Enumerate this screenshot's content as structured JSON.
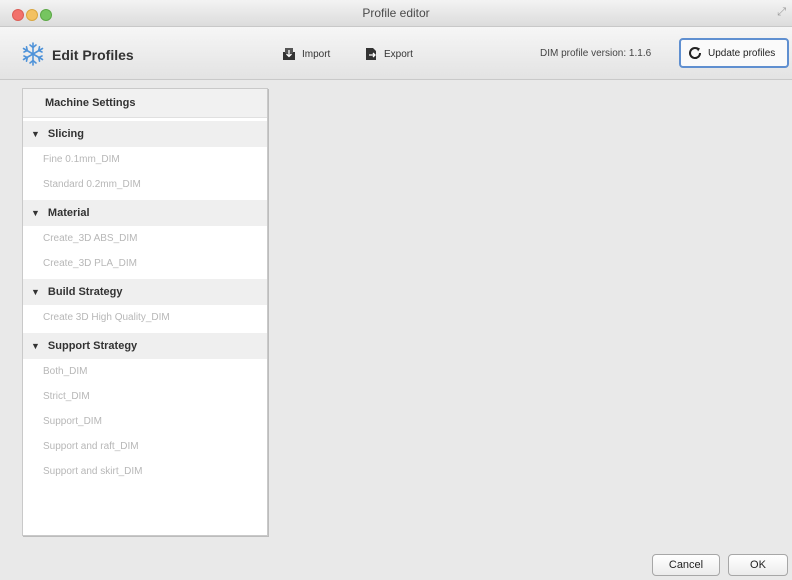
{
  "window": {
    "title": "Profile editor"
  },
  "toolbar": {
    "title": "Edit Profiles",
    "import_label": "Import",
    "export_label": "Export",
    "version_text": "DIM profile version: 1.1.6",
    "update_label": "Update profiles"
  },
  "sidebar": {
    "header": "Machine Settings",
    "sections": [
      {
        "label": "Slicing",
        "items": [
          "Fine 0.1mm_DIM",
          "Standard 0.2mm_DIM"
        ]
      },
      {
        "label": "Material",
        "items": [
          "Create_3D ABS_DIM",
          "Create_3D PLA_DIM"
        ]
      },
      {
        "label": "Build Strategy",
        "items": [
          "Create 3D High Quality_DIM"
        ]
      },
      {
        "label": "Support Strategy",
        "items": [
          "Both_DIM",
          "Strict_DIM",
          "Support_DIM",
          "Support and raft_DIM",
          "Support and skirt_DIM"
        ]
      }
    ]
  },
  "footer": {
    "cancel_label": "Cancel",
    "ok_label": "OK"
  },
  "colors": {
    "accent": "#5f8fd0",
    "close": "#f2716b",
    "minimize": "#f3c162",
    "maximize": "#76c560"
  },
  "icons": {
    "brand": "snowflake-icon",
    "import": "import-icon",
    "export": "export-icon",
    "update": "refresh-icon",
    "section": "triangle-down-icon"
  }
}
